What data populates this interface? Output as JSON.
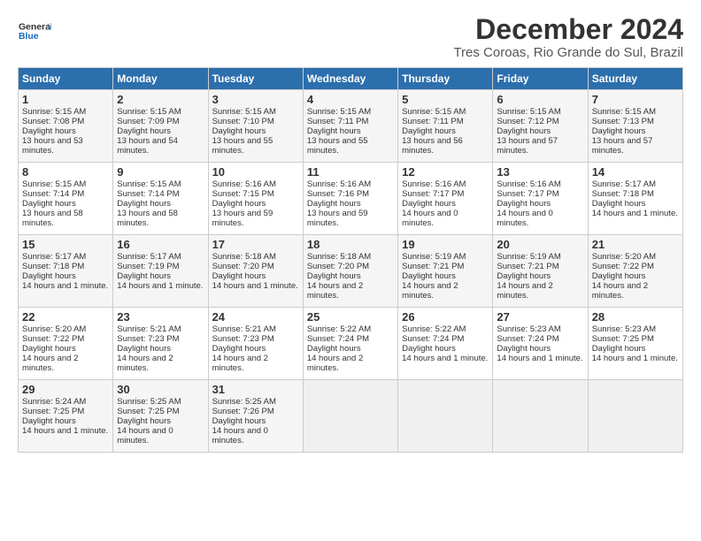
{
  "logo": {
    "line1": "General",
    "line2": "Blue"
  },
  "title": "December 2024",
  "location": "Tres Coroas, Rio Grande do Sul, Brazil",
  "days_of_week": [
    "Sunday",
    "Monday",
    "Tuesday",
    "Wednesday",
    "Thursday",
    "Friday",
    "Saturday"
  ],
  "weeks": [
    [
      {
        "day": "1",
        "sunrise": "5:15 AM",
        "sunset": "7:08 PM",
        "daylight": "13 hours and 53 minutes."
      },
      {
        "day": "2",
        "sunrise": "5:15 AM",
        "sunset": "7:09 PM",
        "daylight": "13 hours and 54 minutes."
      },
      {
        "day": "3",
        "sunrise": "5:15 AM",
        "sunset": "7:10 PM",
        "daylight": "13 hours and 55 minutes."
      },
      {
        "day": "4",
        "sunrise": "5:15 AM",
        "sunset": "7:11 PM",
        "daylight": "13 hours and 55 minutes."
      },
      {
        "day": "5",
        "sunrise": "5:15 AM",
        "sunset": "7:11 PM",
        "daylight": "13 hours and 56 minutes."
      },
      {
        "day": "6",
        "sunrise": "5:15 AM",
        "sunset": "7:12 PM",
        "daylight": "13 hours and 57 minutes."
      },
      {
        "day": "7",
        "sunrise": "5:15 AM",
        "sunset": "7:13 PM",
        "daylight": "13 hours and 57 minutes."
      }
    ],
    [
      {
        "day": "8",
        "sunrise": "5:15 AM",
        "sunset": "7:14 PM",
        "daylight": "13 hours and 58 minutes."
      },
      {
        "day": "9",
        "sunrise": "5:15 AM",
        "sunset": "7:14 PM",
        "daylight": "13 hours and 58 minutes."
      },
      {
        "day": "10",
        "sunrise": "5:16 AM",
        "sunset": "7:15 PM",
        "daylight": "13 hours and 59 minutes."
      },
      {
        "day": "11",
        "sunrise": "5:16 AM",
        "sunset": "7:16 PM",
        "daylight": "13 hours and 59 minutes."
      },
      {
        "day": "12",
        "sunrise": "5:16 AM",
        "sunset": "7:17 PM",
        "daylight": "14 hours and 0 minutes."
      },
      {
        "day": "13",
        "sunrise": "5:16 AM",
        "sunset": "7:17 PM",
        "daylight": "14 hours and 0 minutes."
      },
      {
        "day": "14",
        "sunrise": "5:17 AM",
        "sunset": "7:18 PM",
        "daylight": "14 hours and 1 minute."
      }
    ],
    [
      {
        "day": "15",
        "sunrise": "5:17 AM",
        "sunset": "7:18 PM",
        "daylight": "14 hours and 1 minute."
      },
      {
        "day": "16",
        "sunrise": "5:17 AM",
        "sunset": "7:19 PM",
        "daylight": "14 hours and 1 minute."
      },
      {
        "day": "17",
        "sunrise": "5:18 AM",
        "sunset": "7:20 PM",
        "daylight": "14 hours and 1 minute."
      },
      {
        "day": "18",
        "sunrise": "5:18 AM",
        "sunset": "7:20 PM",
        "daylight": "14 hours and 2 minutes."
      },
      {
        "day": "19",
        "sunrise": "5:19 AM",
        "sunset": "7:21 PM",
        "daylight": "14 hours and 2 minutes."
      },
      {
        "day": "20",
        "sunrise": "5:19 AM",
        "sunset": "7:21 PM",
        "daylight": "14 hours and 2 minutes."
      },
      {
        "day": "21",
        "sunrise": "5:20 AM",
        "sunset": "7:22 PM",
        "daylight": "14 hours and 2 minutes."
      }
    ],
    [
      {
        "day": "22",
        "sunrise": "5:20 AM",
        "sunset": "7:22 PM",
        "daylight": "14 hours and 2 minutes."
      },
      {
        "day": "23",
        "sunrise": "5:21 AM",
        "sunset": "7:23 PM",
        "daylight": "14 hours and 2 minutes."
      },
      {
        "day": "24",
        "sunrise": "5:21 AM",
        "sunset": "7:23 PM",
        "daylight": "14 hours and 2 minutes."
      },
      {
        "day": "25",
        "sunrise": "5:22 AM",
        "sunset": "7:24 PM",
        "daylight": "14 hours and 2 minutes."
      },
      {
        "day": "26",
        "sunrise": "5:22 AM",
        "sunset": "7:24 PM",
        "daylight": "14 hours and 1 minute."
      },
      {
        "day": "27",
        "sunrise": "5:23 AM",
        "sunset": "7:24 PM",
        "daylight": "14 hours and 1 minute."
      },
      {
        "day": "28",
        "sunrise": "5:23 AM",
        "sunset": "7:25 PM",
        "daylight": "14 hours and 1 minute."
      }
    ],
    [
      {
        "day": "29",
        "sunrise": "5:24 AM",
        "sunset": "7:25 PM",
        "daylight": "14 hours and 1 minute."
      },
      {
        "day": "30",
        "sunrise": "5:25 AM",
        "sunset": "7:25 PM",
        "daylight": "14 hours and 0 minutes."
      },
      {
        "day": "31",
        "sunrise": "5:25 AM",
        "sunset": "7:26 PM",
        "daylight": "14 hours and 0 minutes."
      },
      null,
      null,
      null,
      null
    ]
  ]
}
